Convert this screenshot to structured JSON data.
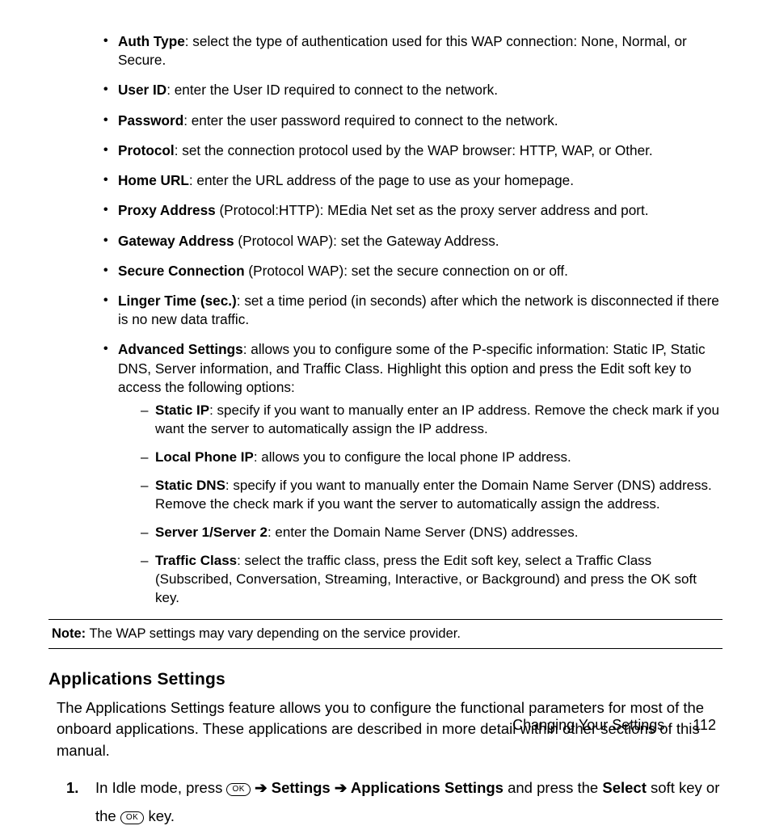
{
  "bullets": [
    {
      "label": "Auth Type",
      "text": ": select the type of authentication used for this WAP connection: None, Normal, or Secure."
    },
    {
      "label": "User ID",
      "text": ": enter the User ID required to connect to the network."
    },
    {
      "label": "Password",
      "text": ": enter the user password required to connect to the network."
    },
    {
      "label": "Protocol",
      "text": ": set the connection protocol used by the WAP browser: HTTP, WAP, or Other."
    },
    {
      "label": "Home URL",
      "text": ": enter the URL address of the page to use as your homepage."
    },
    {
      "label": "Proxy Address",
      "text": " (Protocol:HTTP): MEdia Net set as the proxy server address and port."
    },
    {
      "label": "Gateway Address",
      "text": " (Protocol WAP): set the Gateway Address."
    },
    {
      "label": "Secure Connection",
      "text": " (Protocol WAP): set the secure connection on or off."
    },
    {
      "label": "Linger Time (sec.)",
      "text": ": set a time period (in seconds) after which the network is disconnected if there is no new data traffic."
    },
    {
      "label": "Advanced Settings",
      "text": ": allows you to configure some of the  P-specific information: Static IP, Static DNS, Server information, and Traffic Class. Highlight this option and press the Edit soft key to access the following options:"
    }
  ],
  "dashes": [
    {
      "label": "Static IP",
      "text": ": specify if you want to manually enter an IP address. Remove the check mark if you want the server to automatically assign the IP address."
    },
    {
      "label": "Local Phone IP",
      "text": ": allows you to configure the local phone IP address."
    },
    {
      "label": "Static DNS",
      "text": ": specify if you want to manually enter the Domain Name Server (DNS) address. Remove the check mark if you want the server to automatically assign the address."
    },
    {
      "label": "Server 1/Server 2",
      "text": ": enter the Domain Name Server (DNS) addresses."
    },
    {
      "label": "Traffic Class",
      "text": ": select the traffic class, press the Edit soft key, select a Traffic Class (Subscribed, Conversation, Streaming, Interactive, or Background) and press the OK soft key."
    }
  ],
  "note": {
    "label": "Note:",
    "text": " The WAP settings may vary depending on the service provider."
  },
  "section_heading": "Applications Settings",
  "section_body": "The Applications Settings feature allows you to configure the functional parameters for most of the onboard applications. These applications are described in more detail within other sections of this manual.",
  "step": {
    "num": "1.",
    "pre": "In Idle mode, press ",
    "ok": "OK",
    "arrow": " ➔ ",
    "b1": "Settings",
    "b2": "Applications Settings",
    "mid": " and press the ",
    "b3": "Select",
    "post1": " soft key or the ",
    "post2": " key."
  },
  "footer": {
    "title": "Changing Your Settings",
    "page": "112"
  }
}
